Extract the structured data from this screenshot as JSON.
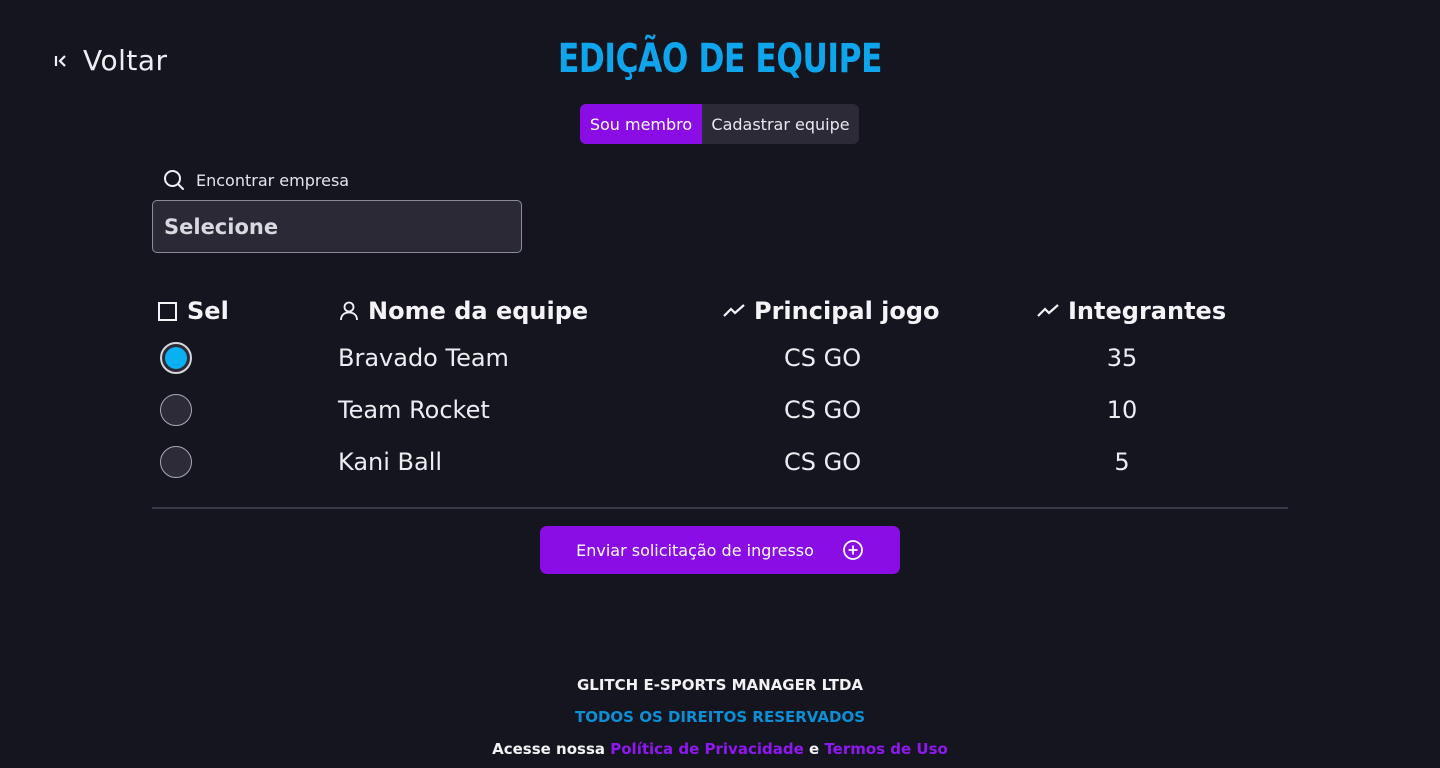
{
  "header": {
    "back_label": "Voltar",
    "title": "EDIÇÃO DE EQUIPE"
  },
  "tabs": [
    {
      "label": "Sou membro",
      "active": true
    },
    {
      "label": "Cadastrar equipe",
      "active": false
    }
  ],
  "search": {
    "label": "Encontrar empresa",
    "selected": "Selecione"
  },
  "table": {
    "columns": {
      "select": "Sel",
      "name": "Nome da equipe",
      "game": "Principal jogo",
      "members": "Integrantes"
    },
    "rows": [
      {
        "name": "Bravado Team",
        "game": "CS GO",
        "members": "35",
        "selected": true
      },
      {
        "name": "Team Rocket",
        "game": "CS GO",
        "members": "10",
        "selected": false
      },
      {
        "name": "Kani Ball",
        "game": "CS GO",
        "members": "5",
        "selected": false
      }
    ]
  },
  "submit": {
    "label": "Enviar solicitação de ingresso"
  },
  "footer": {
    "company": "GLITCH E-SPORTS MANAGER LTDA",
    "rights": "TODOS OS DIREITOS RESERVADOS",
    "access_prefix": "Acesse nossa",
    "privacy_link": "Política de Privacidade",
    "conjunction": "e",
    "terms_link": "Termos de Uso"
  },
  "colors": {
    "background": "#15151f",
    "accent_purple": "#8a0de6",
    "accent_blue": "#0ea5ec"
  },
  "icons": {
    "back": "first-page-icon",
    "search": "search-icon",
    "checkbox": "checkbox-icon",
    "user": "user-icon",
    "trend": "trending-icon",
    "add": "add-circle-icon"
  }
}
